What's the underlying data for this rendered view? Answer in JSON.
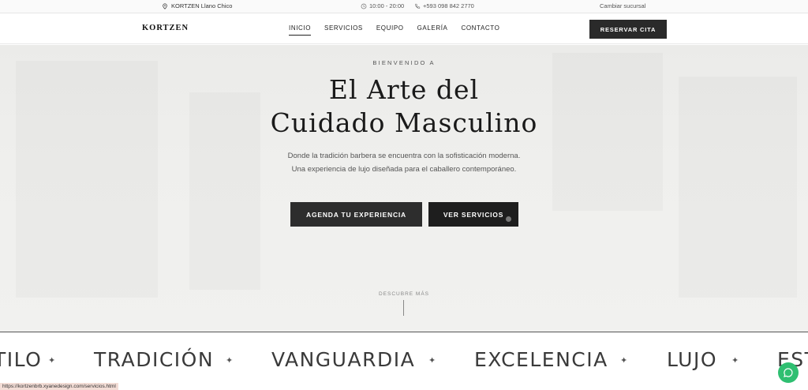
{
  "topbar": {
    "location": "KORTZEN Llano Chico",
    "hours": "10:00 - 20:00",
    "phone": "+593 098 842 2770",
    "branch": "Cambiar sucursal"
  },
  "nav": {
    "logo": "KORTZEN",
    "menu": [
      "INICIO",
      "SERVICIOS",
      "EQUIPO",
      "GALERÍA",
      "CONTACTO"
    ],
    "cta": "RESERVAR CITA"
  },
  "hero": {
    "welcome": "BIENVENIDO A",
    "title_line1": "El Arte del",
    "title_line2": "Cuidado Masculino",
    "subtitle": "Donde la tradición barbera se encuentra con la sofisticación moderna. Una experiencia de lujo diseñada para el caballero contemporáneo.",
    "btn_primary": "AGENDA TU EXPERIENCIA",
    "btn_secondary": "VER SERVICIOS",
    "discover": "DESCUBRE MÁS"
  },
  "marquee": {
    "items": [
      "TILO",
      "TRADICIÓN",
      "VANGUARDIA",
      "EXCELENCIA",
      "LUJO",
      "EST"
    ],
    "separator": "✦"
  },
  "status_url": "https://kortzenbrb.xyanedesign.com/servicios.html",
  "colors": {
    "dark": "#2a2a2a",
    "chat": "#2fbf71"
  },
  "icons": [
    "location-pin-icon",
    "clock-icon",
    "phone-icon",
    "chat-icon"
  ]
}
